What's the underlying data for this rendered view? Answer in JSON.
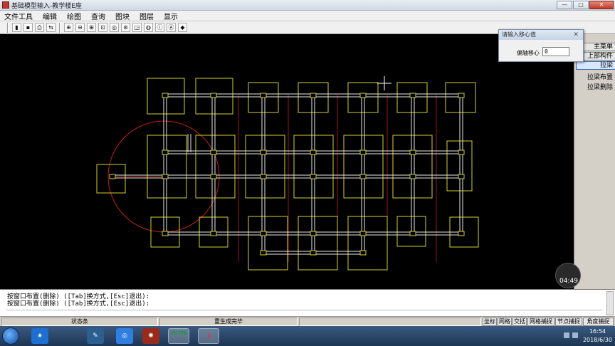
{
  "window": {
    "title": "基础模型输入-教学楼E座",
    "controls": [
      "—",
      "□",
      "✕"
    ]
  },
  "menu": [
    "文件工具",
    "编辑",
    "绘图",
    "查询",
    "图块",
    "图层",
    "显示"
  ],
  "toolbar": {
    "icons": [
      "folder-icon",
      "save-icon",
      "print-icon",
      "export-icon",
      "zoom-in-icon",
      "zoom-out-icon",
      "zoom-window-icon",
      "zoom-extents-icon",
      "zoom-previous-icon",
      "zoom-realtime-icon",
      "view-3d-icon",
      "render-icon",
      "info-icon",
      "text-icon",
      "layer-icon"
    ],
    "glyphs": [
      "▮",
      "▪",
      "⎙",
      "⇆",
      "⊕",
      "⊖",
      "⊞",
      "⊡",
      "◎",
      "⊛",
      "◲",
      "◍",
      "ⓘ",
      "Ⓐ",
      "◆"
    ]
  },
  "right_panel": {
    "main_menu": "主菜单",
    "upper_components": "上部构件",
    "beam_section": "拉梁",
    "items": [
      "拉梁布置",
      "拉梁删除"
    ]
  },
  "dialog": {
    "title": "请输入移心值",
    "close": "✕",
    "field_label": "偏轴移心",
    "field_value": "0"
  },
  "timer": {
    "label": "04:49"
  },
  "command": {
    "lines": [
      "按窗口布置(删除) ([Tab]换方式,[Esc]退出):",
      "按窗口布置(删除) ([Tab]换方式,[Esc]退出):"
    ]
  },
  "status": {
    "state": "状态条",
    "regen": "重生成完毕",
    "toggles": [
      "坐标",
      "网格",
      "交括",
      "网格捕捉",
      "节点捕捉",
      "角度捕捉"
    ]
  },
  "taskbar": {
    "apps": [
      "start-orb",
      "app-star",
      "app-notes",
      "app-browser",
      "app-gear",
      "app-pkpm",
      "app-download"
    ],
    "app_labels": [
      "",
      "★",
      "✎",
      "◎",
      "✺",
      "PK PM",
      "⬇"
    ],
    "clock_time": "16:54",
    "clock_date": "2018/6/30"
  }
}
